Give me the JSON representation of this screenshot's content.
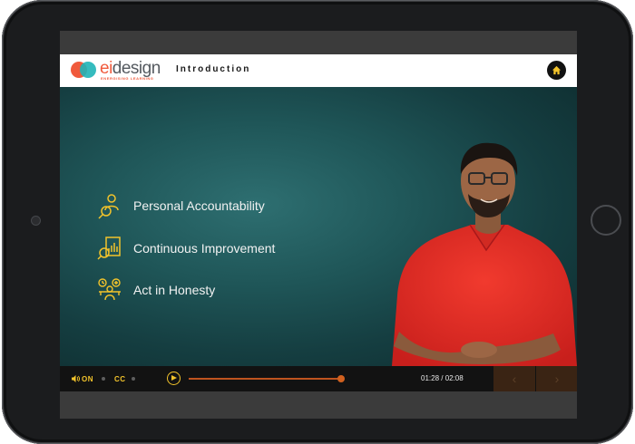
{
  "header": {
    "logo_brand_prefix": "ei",
    "logo_brand_suffix": "design",
    "logo_tagline": "ENERGISING LEARNING",
    "title": "Introduction"
  },
  "slide": {
    "bullets": [
      {
        "label": "Personal Accountability",
        "icon": "person-search-icon"
      },
      {
        "label": "Continuous Improvement",
        "icon": "chart-search-icon"
      },
      {
        "label": "Act in Honesty",
        "icon": "honesty-scale-icon"
      }
    ]
  },
  "controls": {
    "audio_label": "ON",
    "cc_label": "CC",
    "time": "01:28 / 02:08",
    "progress_fraction": 0.99,
    "prev_symbol": "‹",
    "next_symbol": "›"
  },
  "colors": {
    "accent": "#f2c32b",
    "progress": "#c0541f",
    "brand_orange": "#f05a3c",
    "brand_teal": "#1fb4b7"
  }
}
